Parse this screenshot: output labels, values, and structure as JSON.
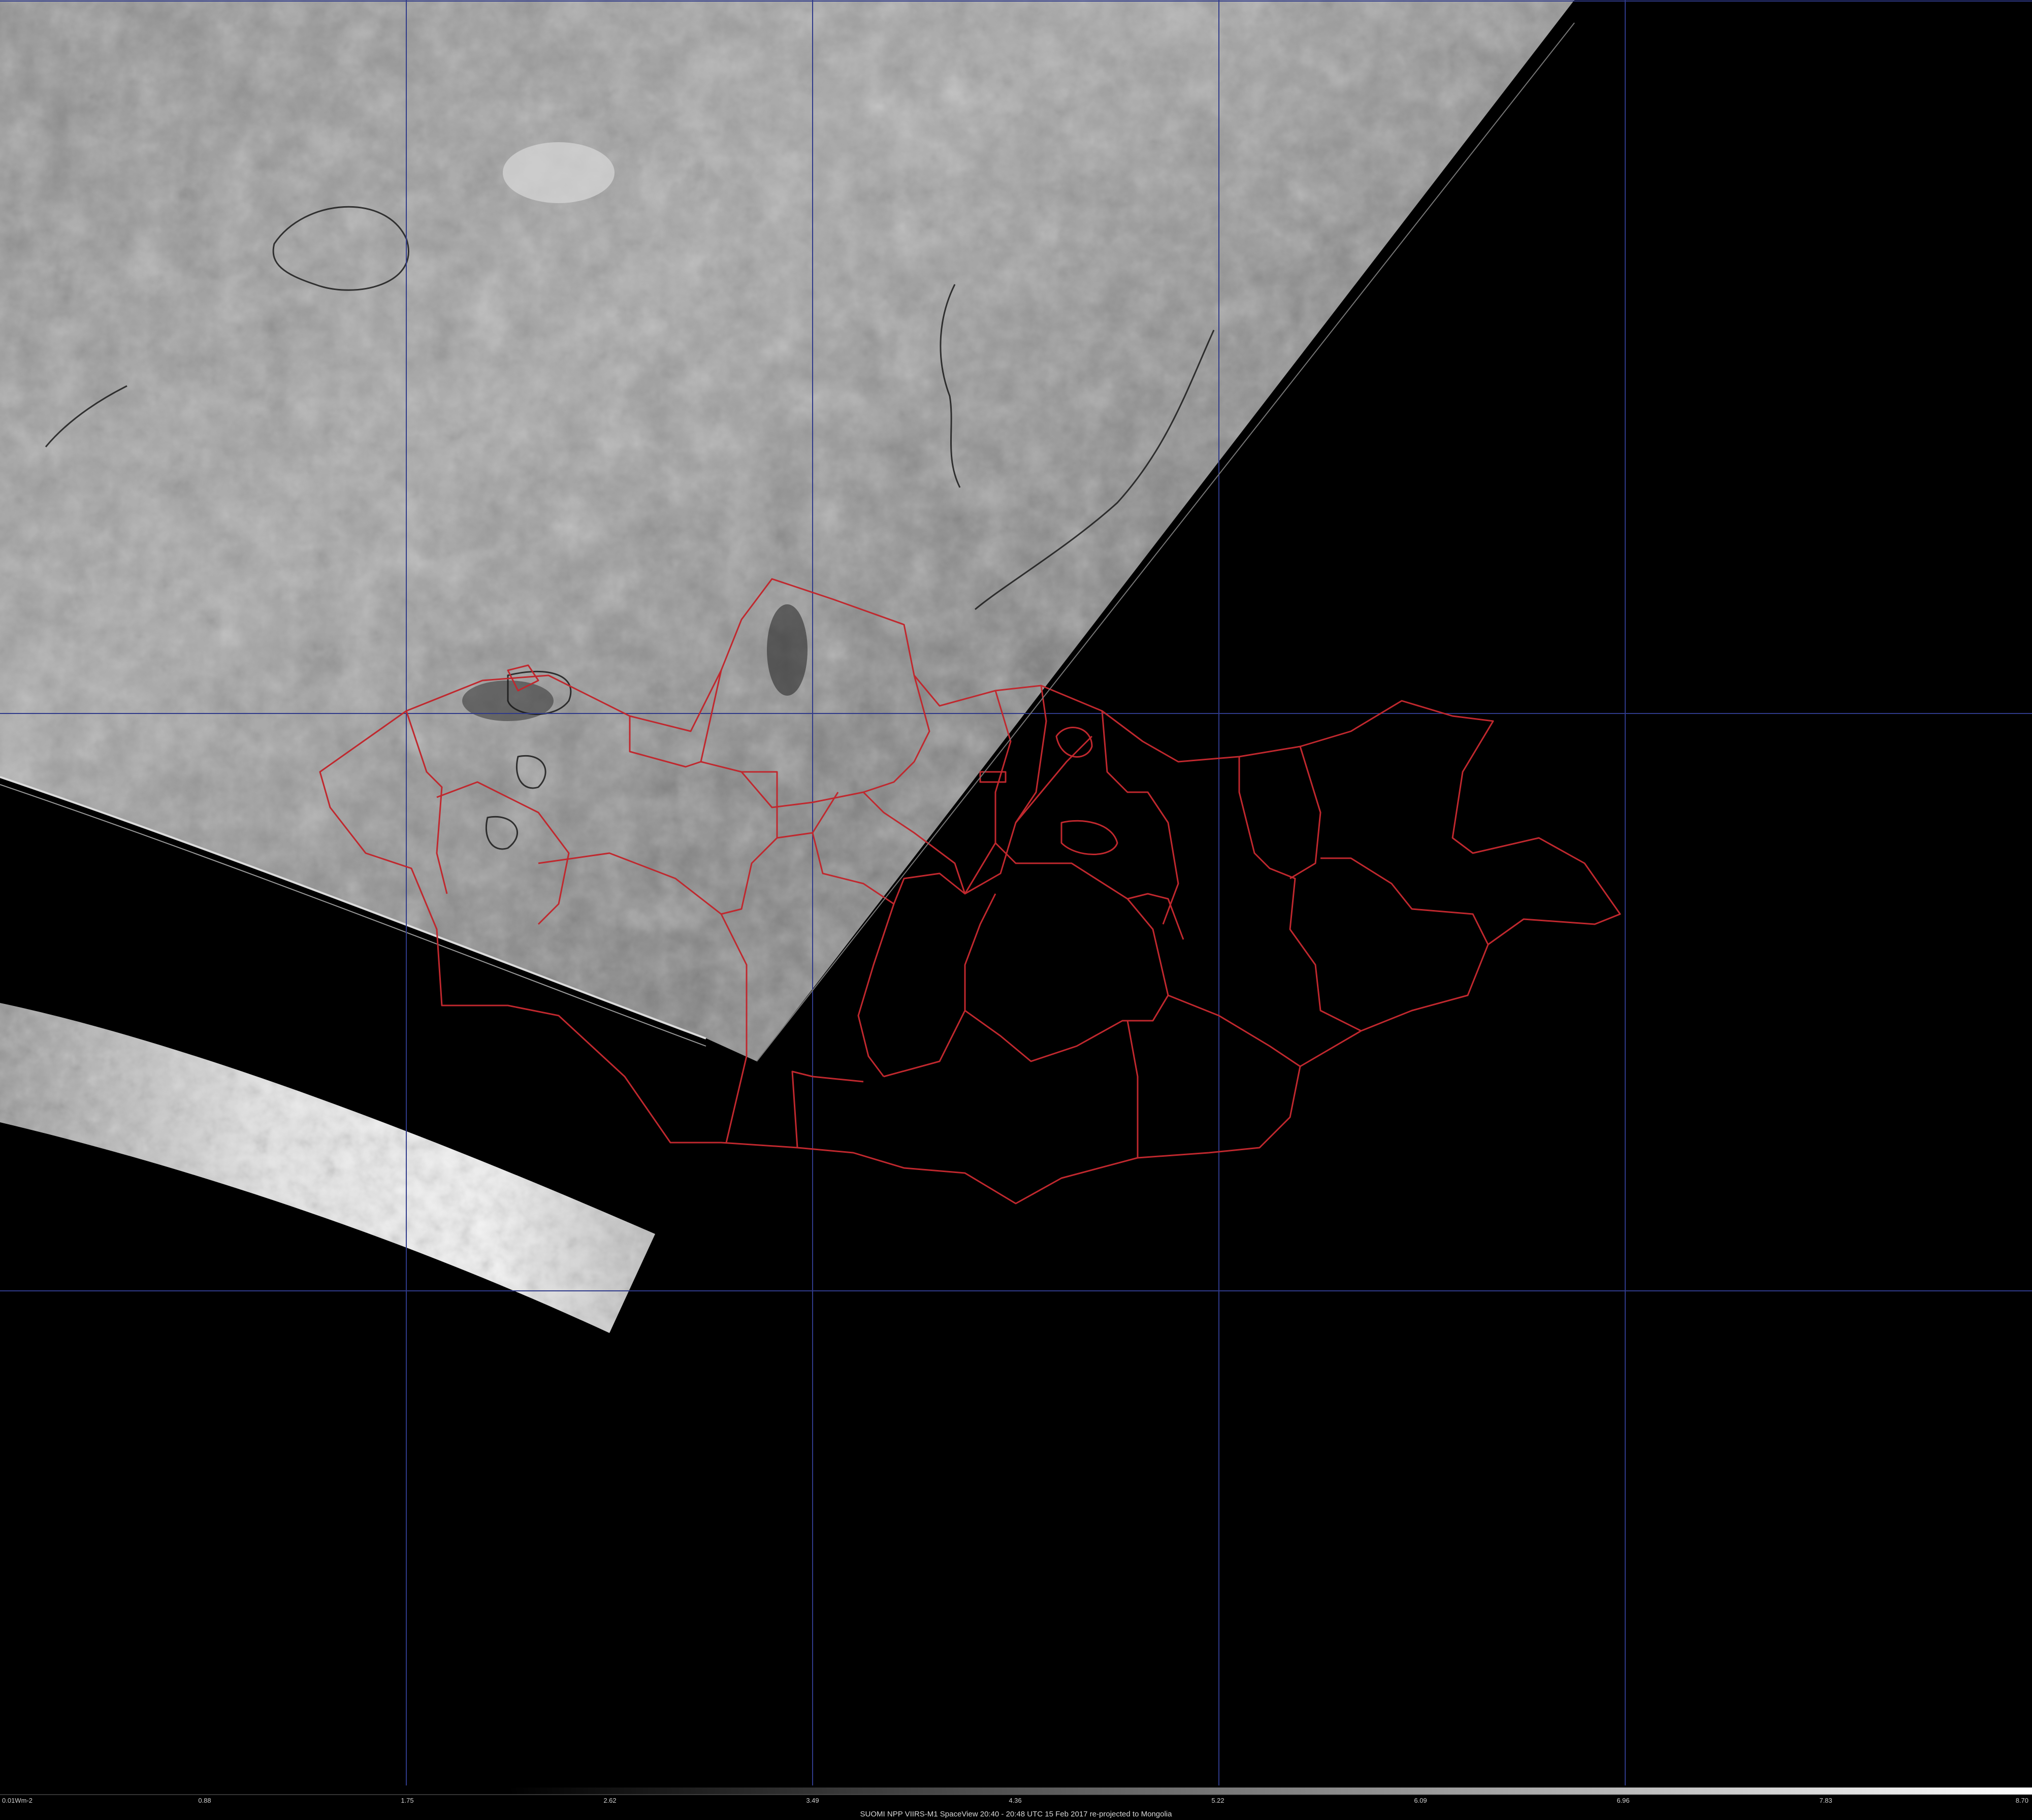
{
  "caption": "SUOMI NPP VIIRS-M1 SpaceView 20:40 - 20:48 UTC 15 Feb 2017 re-projected to Mongolia",
  "colorbar": {
    "ticks": [
      "0.01Wm-2",
      "0.88",
      "1.75",
      "2.62",
      "3.49",
      "4.36",
      "5.22",
      "6.09",
      "6.96",
      "7.83",
      "8.70"
    ]
  },
  "colors": {
    "background": "#000000",
    "graticule": "#2f3a8a",
    "borders": "#c0282e",
    "coastline": "#111111"
  }
}
